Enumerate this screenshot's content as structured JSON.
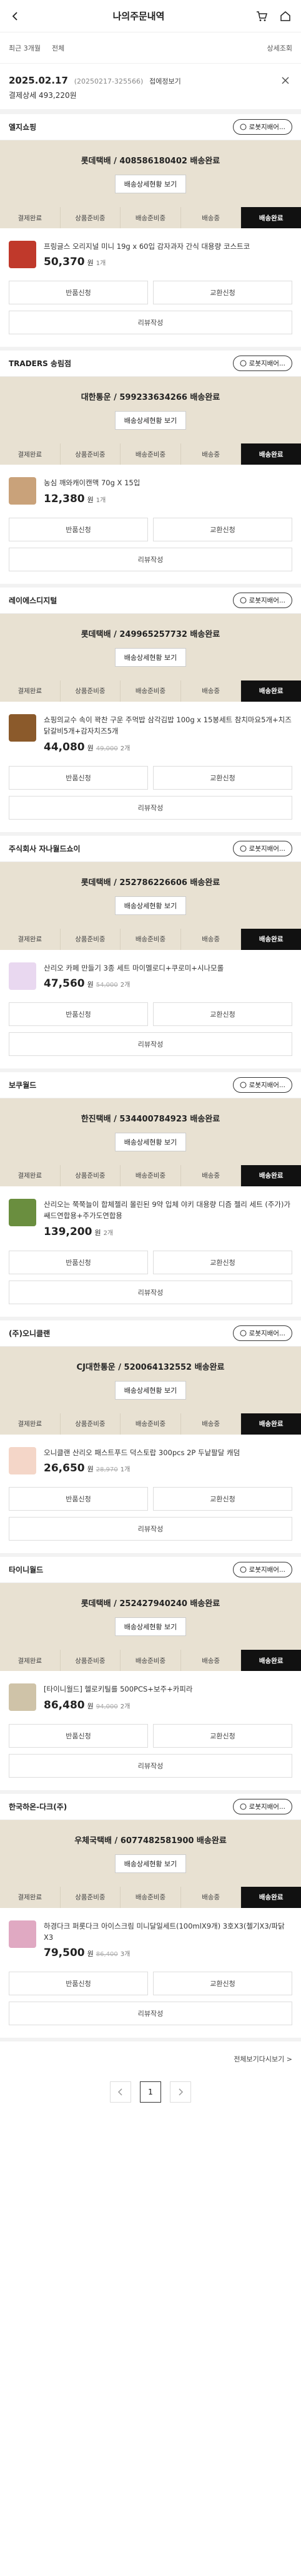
{
  "header": {
    "title": "나의주문내역"
  },
  "filters": {
    "period": "최근 3개월",
    "status": "전체",
    "detail": "상세조회"
  },
  "order": {
    "date": "2025.02.17",
    "order_no": "(20250217-325566)",
    "hide_label": "접에정보기",
    "total": "결제상세 493,220원"
  },
  "common": {
    "chat_label": "로봇지배어...",
    "track_label": "배송상세현황 보기",
    "steps": [
      "결제완료",
      "상품준비중",
      "배송준비중",
      "배송중",
      "배송완료"
    ],
    "cancel": "반품신청",
    "exchange": "교환신청",
    "review": "리뷰작성"
  },
  "stores": [
    {
      "name": "엘지쇼핑",
      "courier": "롯데택배 / 408586180402 배송완료",
      "item": "프링글스 오리지널 미니 19g x 60입 감자과자 간식 대용량 코스트코",
      "price": "50,370",
      "orig": "",
      "qty": "1개",
      "thumb": "#c0392b"
    },
    {
      "name": "TRADERS 송림점",
      "courier": "대한통운 / 599233634266 배송완료",
      "item": "농심 깨와캐이캔맥 70g X 15입",
      "price": "12,380",
      "orig": "",
      "qty": "1개",
      "thumb": "#c9a27a"
    },
    {
      "name": "레이에스디지털",
      "courier": "롯데택배 / 249965257732 배송완료",
      "item": "쇼핑의교수 속이 꽉찬 구운 주먹밥 삼각김밥 100g x 15봉세트 참치마요5개+치즈닭갈비5개+감자치즈5개",
      "price": "44,080",
      "orig": "49,000",
      "qty": "2개",
      "thumb": "#8b5a2b"
    },
    {
      "name": "주식회사 자나월드쇼이",
      "courier": "롯데택배 / 252786226606 배송완료",
      "item": "산리오 카페 만들기 3종 세트 마이멜로디+쿠로미+시나모롤",
      "price": "47,560",
      "orig": "54,000",
      "qty": "2개",
      "thumb": "#e9d8f0"
    },
    {
      "name": "보쿠월드",
      "courier": "한진택배 / 534400784923 배송완료",
      "item": "산리오는 쭉쭉늘이 합체젤리 몰린된 9약 입체 야키 대용량 디즘 젤리 세트 (주가)가쌔드연합용+주가도연합용",
      "price": "139,200",
      "orig": "",
      "qty": "2개",
      "thumb": "#6a8e3f"
    },
    {
      "name": "(주)오니클랜",
      "courier": "CJ대한통운 / 520064132552 배송완료",
      "item": "오니클랜 산리오 패스트푸드 덕스토랍 300pcs 2P 두낱팔달 캐덤",
      "price": "26,650",
      "orig": "28,970",
      "qty": "1개",
      "thumb": "#f4d6c8"
    },
    {
      "name": "타이니월드",
      "courier": "롯데택배 / 252427940240 배송완료",
      "item": "[타이니월드] 헬로키틸를 500PCS+보주+카피라",
      "price": "86,480",
      "orig": "94,000",
      "qty": "2개",
      "thumb": "#cfc3a8"
    },
    {
      "name": "한국하온-다크(주)",
      "courier": "우체국택배 / 6077482581900 배송완료",
      "item": "하경다크 퍼롯다크 아이스크림 미니달일세트(100mlX9개) 3호X3(첼기X3/파닭X3",
      "price": "79,500",
      "orig": "86,400",
      "qty": "3개",
      "thumb": "#e0a9c2"
    }
  ],
  "more_label": "전체보기다시보기 >",
  "pager": {
    "current": "1"
  }
}
